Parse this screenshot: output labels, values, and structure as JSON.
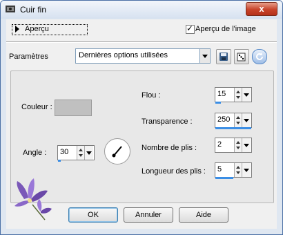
{
  "window": {
    "title": "Cuir fin",
    "close_label": "x"
  },
  "preview": {
    "toggle_label": "Aperçu",
    "checkbox_label": "Aperçu de l'image",
    "checked": true
  },
  "settings": {
    "label": "Paramètres",
    "selected": "Dernières options utilisées"
  },
  "color": {
    "label": "Couleur :",
    "value": "#c0c0c0"
  },
  "angle": {
    "label": "Angle :",
    "value": "30",
    "level": 0.08
  },
  "flou": {
    "label": "Flou :",
    "value": "15",
    "level": 0.15
  },
  "transparence": {
    "label": "Transparence :",
    "value": "250",
    "level": 1.0
  },
  "plis": {
    "label": "Nombre de plis :",
    "value": "2",
    "level": 0.0
  },
  "longueur": {
    "label": "Longueur des plis :",
    "value": "5",
    "level": 0.5
  },
  "buttons": {
    "ok": "OK",
    "cancel": "Annuler",
    "help": "Aide"
  },
  "icons": {
    "save": "save-icon",
    "dice": "random-icon",
    "reset": "reset-icon",
    "app": "app-icon",
    "flower": "flower-icon"
  }
}
